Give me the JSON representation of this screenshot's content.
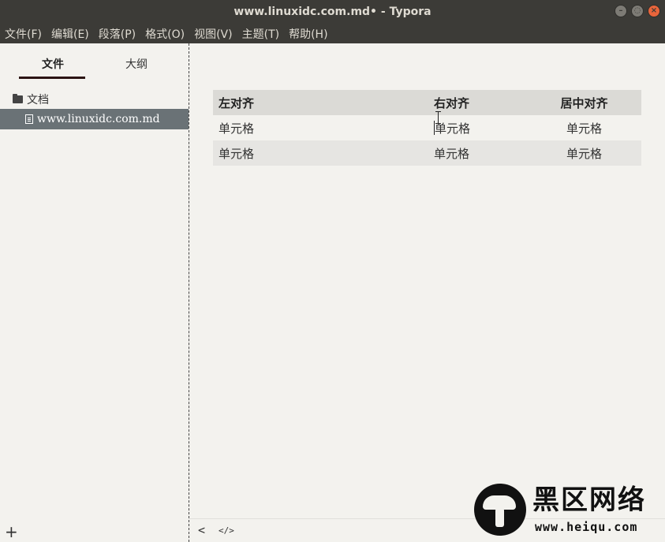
{
  "window": {
    "title": "www.linuxidc.com.md• - Typora",
    "controls": {
      "minimize": "–",
      "maximize": "◌",
      "close": "×"
    }
  },
  "menu": [
    "文件(F)",
    "编辑(E)",
    "段落(P)",
    "格式(O)",
    "视图(V)",
    "主题(T)",
    "帮助(H)"
  ],
  "sidebar": {
    "tabs": {
      "files": "文件",
      "outline": "大纲"
    },
    "folder": "文档",
    "file": "www.linuxidc.com.md",
    "add_label": "+"
  },
  "table": {
    "headers": [
      "左对齐",
      "右对齐",
      "居中对齐"
    ],
    "rows": [
      [
        "单元格",
        "单元格",
        "单元格"
      ],
      [
        "单元格",
        "单元格",
        "单元格"
      ]
    ]
  },
  "statusbar": {
    "back": "<",
    "source": "</>"
  },
  "watermark": {
    "title": "黑区网络",
    "url": "www.heiqu.com"
  },
  "colors": {
    "titlebar": "#3c3b37",
    "close_button": "#e9653b",
    "selected_file": "#6a7276",
    "table_header": "#dbdad6"
  }
}
